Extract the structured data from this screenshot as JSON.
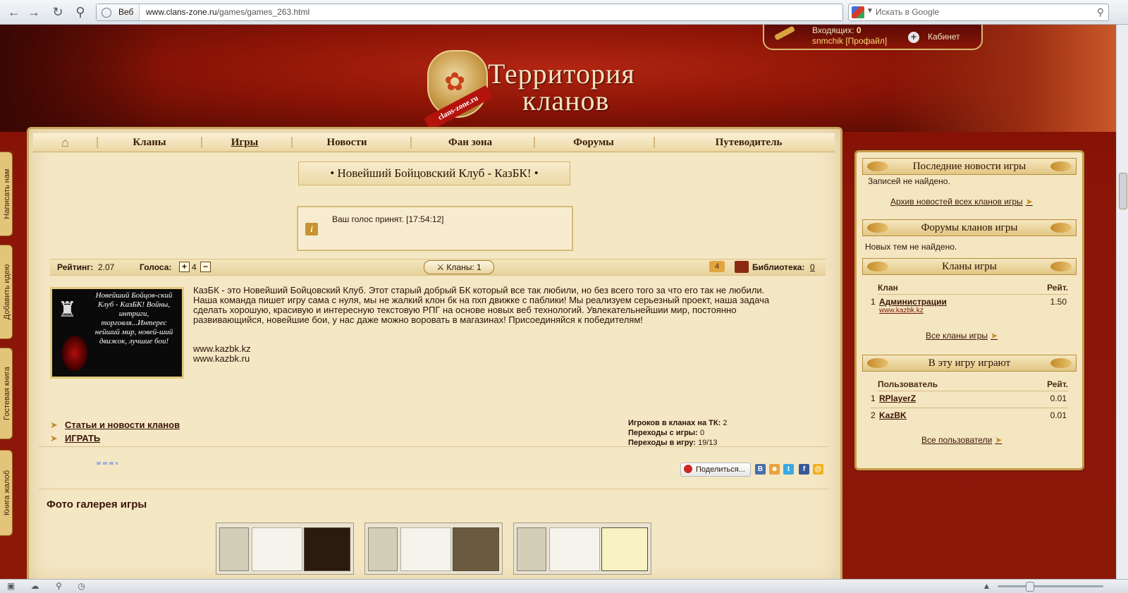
{
  "browser": {
    "address_mode": "Веб",
    "url_host": "www.clans-zone.ru",
    "url_path": "/games/games_263.html",
    "search_placeholder": "Искать в Google"
  },
  "header": {
    "logo_ribbon": "clans-zone.ru",
    "title_line1": "Территория",
    "title_line2": "кланов",
    "inbox_label": "Входящих:",
    "inbox_count": "0",
    "username": "snmchik [Профайл]",
    "cabinet": "Кабинет"
  },
  "sidetabs": [
    "Написать нам",
    "Добавить идею",
    "Гостевая книга",
    "Книга жалоб"
  ],
  "menu": [
    "Кланы",
    "Игры",
    "Новости",
    "Фан зона",
    "Форумы",
    "Путеводитель"
  ],
  "game": {
    "title": "•  Новейший Бойцовский Клуб - КазБК!  •",
    "notice": "Ваш голос принят. [17:54:12]",
    "rating_label": "Рейтинг:",
    "rating_value": "2.07",
    "votes_label": "Голоса:",
    "votes_value": "4",
    "clans_button": "Кланы: 1",
    "comments_count": "4",
    "library_label": "Библиотека:",
    "library_value": "0",
    "cover_text": "Новейший Бойцов-ский Клуб - КазБК! Войны, интриги, торговля...Интерес нейший мир, новей-ший движок, лучшие бои!",
    "description": "КазБК - это Новейший Бойцовский Клуб. Этот старый добрый БК который все так любили, но без всего того за что его так не любили. Наша команда пишет игру сама с нуля, мы не жалкий клон бк на пхп движке с паблики! Мы реализуем серьезный проект, наша задача сделать хорошую, красивую и интересную текстовую РПГ на основе новых веб технологий. Увлекательнейшии мир, постоянно развивающийся, новейшие бои, у нас даже можно воровать в магазинах! Присоединяйся к победителям!",
    "site1": "www.kazbk.kz",
    "site2": "www.kazbk.ru",
    "link_articles": "Статьи и новости кланов",
    "link_play": "ИГРАТЬ",
    "stat1_label": "Игроков в кланах на ТК:",
    "stat1_value": "2",
    "stat2_label": "Переходы с игры:",
    "stat2_value": "0",
    "stat3_label": "Переходы в игру:",
    "stat3_value": "19/13",
    "share_button": "Поделиться...",
    "gallery_title": "Фото галерея игры"
  },
  "sidebar": {
    "news_title": "Последние новости игры",
    "news_empty": "Записей не найдено.",
    "news_archive": "Архив новостей всех кланов игры",
    "forums_title": "Форумы кланов игры",
    "forums_empty": "Новых тем не найдено.",
    "clans_title": "Кланы игры",
    "clans_col_name": "Клан",
    "clans_col_rating": "Рейт.",
    "clans": [
      {
        "n": "1",
        "name": "Администрации",
        "site": "www.kazbk.kz",
        "rating": "1.50"
      }
    ],
    "clans_all": "Все кланы игры",
    "players_title": "В эту игру играют",
    "players_col_name": "Пользователь",
    "players_col_rating": "Рейт.",
    "players": [
      {
        "n": "1",
        "name": "RPlayerZ",
        "rating": "0.01"
      },
      {
        "n": "2",
        "name": "KazBK",
        "rating": "0.01"
      }
    ],
    "players_all": "Все пользователи"
  },
  "colors": {
    "brand_red": "#8c1406",
    "parchment": "#f4e7c4",
    "gold": "#c8a560"
  }
}
